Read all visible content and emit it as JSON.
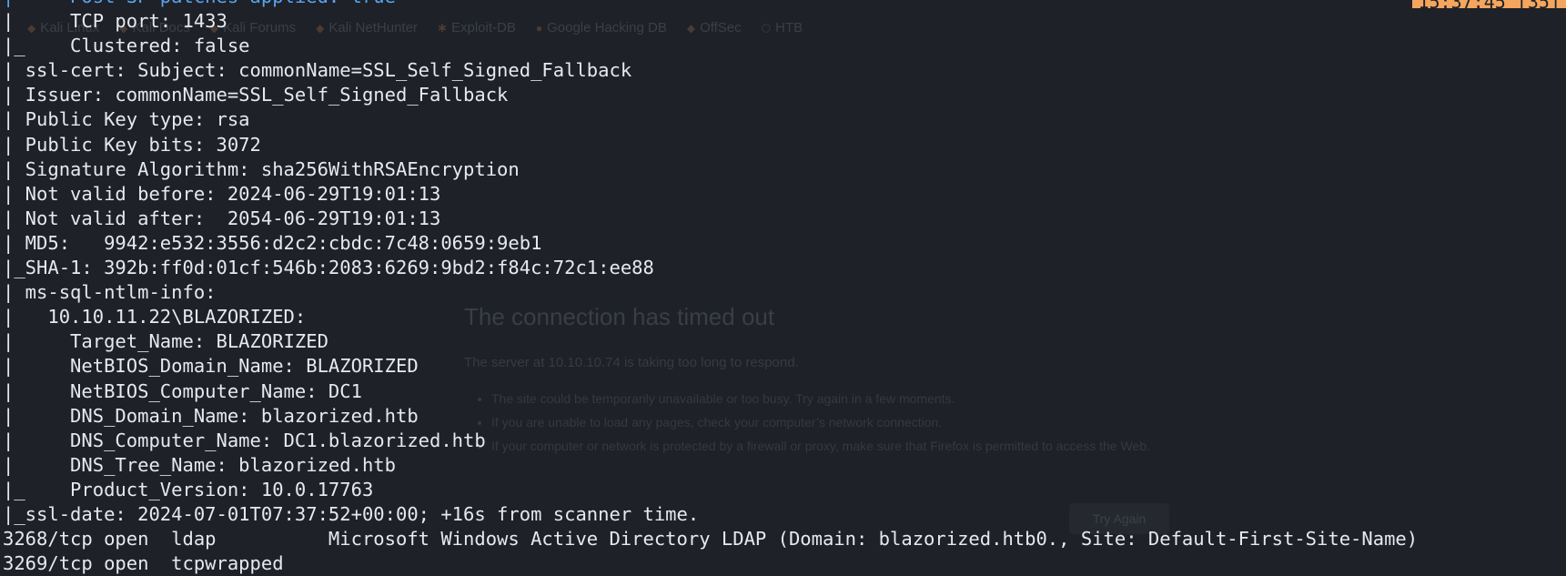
{
  "background_browser": {
    "bookmarks": [
      {
        "icon": "kali-icon",
        "label": "Kali Linux"
      },
      {
        "icon": "kali-icon",
        "label": "Kali Docs"
      },
      {
        "icon": "kali-icon",
        "label": "Kali Forums"
      },
      {
        "icon": "kali-icon",
        "label": "Kali NetHunter"
      },
      {
        "icon": "exploit-icon",
        "label": "Exploit-DB"
      },
      {
        "icon": "google-icon",
        "label": "Google Hacking DB"
      },
      {
        "icon": "offsec-icon",
        "label": "OffSec"
      },
      {
        "icon": "htb-icon",
        "label": "HTB"
      }
    ],
    "error_title": "The connection has timed out",
    "error_message": "The server at 10.10.10.74 is taking too long to respond.",
    "error_tips": [
      "The site could be temporarily unavailable or too busy. Try again in a few moments.",
      "If you are unable to load any pages, check your computer’s network connection.",
      "If your computer or network is protected by a firewall or proxy, make sure that Firefox is permitted to access the Web."
    ],
    "try_again_label": "Try Again"
  },
  "terminal": {
    "clock_text": "15:37:45 [35]",
    "lines": [
      {
        "prefix": "|",
        "text": "     Post-SP patches applied: true",
        "color": "blue"
      },
      {
        "prefix": "|",
        "text": "     TCP port: 1433",
        "color": "white"
      },
      {
        "prefix": "|_",
        "text": "    Clustered: false",
        "color": "white"
      },
      {
        "prefix": "|",
        "text": " ssl-cert: Subject: commonName=SSL_Self_Signed_Fallback",
        "color": "white"
      },
      {
        "prefix": "|",
        "text": " Issuer: commonName=SSL_Self_Signed_Fallback",
        "color": "white"
      },
      {
        "prefix": "|",
        "text": " Public Key type: rsa",
        "color": "white"
      },
      {
        "prefix": "|",
        "text": " Public Key bits: 3072",
        "color": "white"
      },
      {
        "prefix": "|",
        "text": " Signature Algorithm: sha256WithRSAEncryption",
        "color": "white"
      },
      {
        "prefix": "|",
        "text": " Not valid before: 2024-06-29T19:01:13",
        "color": "white"
      },
      {
        "prefix": "|",
        "text": " Not valid after:  2054-06-29T19:01:13",
        "color": "white"
      },
      {
        "prefix": "|",
        "text": " MD5:   9942:e532:3556:d2c2:cbdc:7c48:0659:9eb1",
        "color": "white"
      },
      {
        "prefix": "|",
        "text": "_SHA-1: 392b:ff0d:01cf:546b:2083:6269:9bd2:f84c:72c1:ee88",
        "color": "white"
      },
      {
        "prefix": "|",
        "text": " ms-sql-ntlm-info:",
        "color": "white"
      },
      {
        "prefix": "|",
        "text": "   10.10.11.22\\BLAZORIZED:",
        "color": "white"
      },
      {
        "prefix": "|",
        "text": "     Target_Name: BLAZORIZED",
        "color": "white"
      },
      {
        "prefix": "|",
        "text": "     NetBIOS_Domain_Name: BLAZORIZED",
        "color": "white"
      },
      {
        "prefix": "|",
        "text": "     NetBIOS_Computer_Name: DC1",
        "color": "white"
      },
      {
        "prefix": "|",
        "text": "     DNS_Domain_Name: blazorized.htb",
        "color": "white"
      },
      {
        "prefix": "|",
        "text": "     DNS_Computer_Name: DC1.blazorized.htb",
        "color": "white"
      },
      {
        "prefix": "|",
        "text": "     DNS_Tree_Name: blazorized.htb",
        "color": "white"
      },
      {
        "prefix": "|_",
        "text": "    Product_Version: 10.0.17763",
        "color": "white"
      },
      {
        "prefix": "|",
        "text": "_ssl-date: 2024-07-01T07:37:52+00:00; +16s from scanner time.",
        "color": "white"
      },
      {
        "prefix": "",
        "text": "3268/tcp open  ldap          Microsoft Windows Active Directory LDAP (Domain: blazorized.htb0., Site: Default-First-Site-Name)",
        "color": "white"
      },
      {
        "prefix": "",
        "text": "3269/tcp open  tcpwrapped",
        "color": "white"
      }
    ]
  },
  "colors": {
    "background": "#1e2127",
    "foreground": "#e6e9ef",
    "accent_blue": "#5aa4ee",
    "clock_bg": "#f4a55e"
  }
}
